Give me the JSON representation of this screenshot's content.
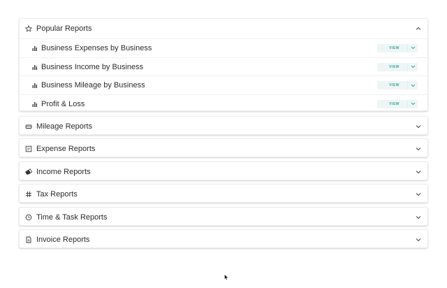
{
  "popular": {
    "title": "Popular Reports",
    "items": [
      {
        "label": "Business Expenses by Business",
        "action": "VIEW"
      },
      {
        "label": "Business Income by Business",
        "action": "VIEW"
      },
      {
        "label": "Business Mileage by Business",
        "action": "VIEW"
      },
      {
        "label": "Profit & Loss",
        "action": "VIEW"
      }
    ]
  },
  "sections": [
    {
      "title": "Mileage Reports",
      "icon": "car-icon"
    },
    {
      "title": "Expense Reports",
      "icon": "receipt-icon"
    },
    {
      "title": "Income Reports",
      "icon": "money-icon"
    },
    {
      "title": "Tax Reports",
      "icon": "grid-icon"
    },
    {
      "title": "Time & Task Reports",
      "icon": "clock-icon"
    },
    {
      "title": "Invoice Reports",
      "icon": "document-icon"
    }
  ],
  "colors": {
    "accent": "#3aa39a",
    "button_bg": "#edf6f5"
  }
}
